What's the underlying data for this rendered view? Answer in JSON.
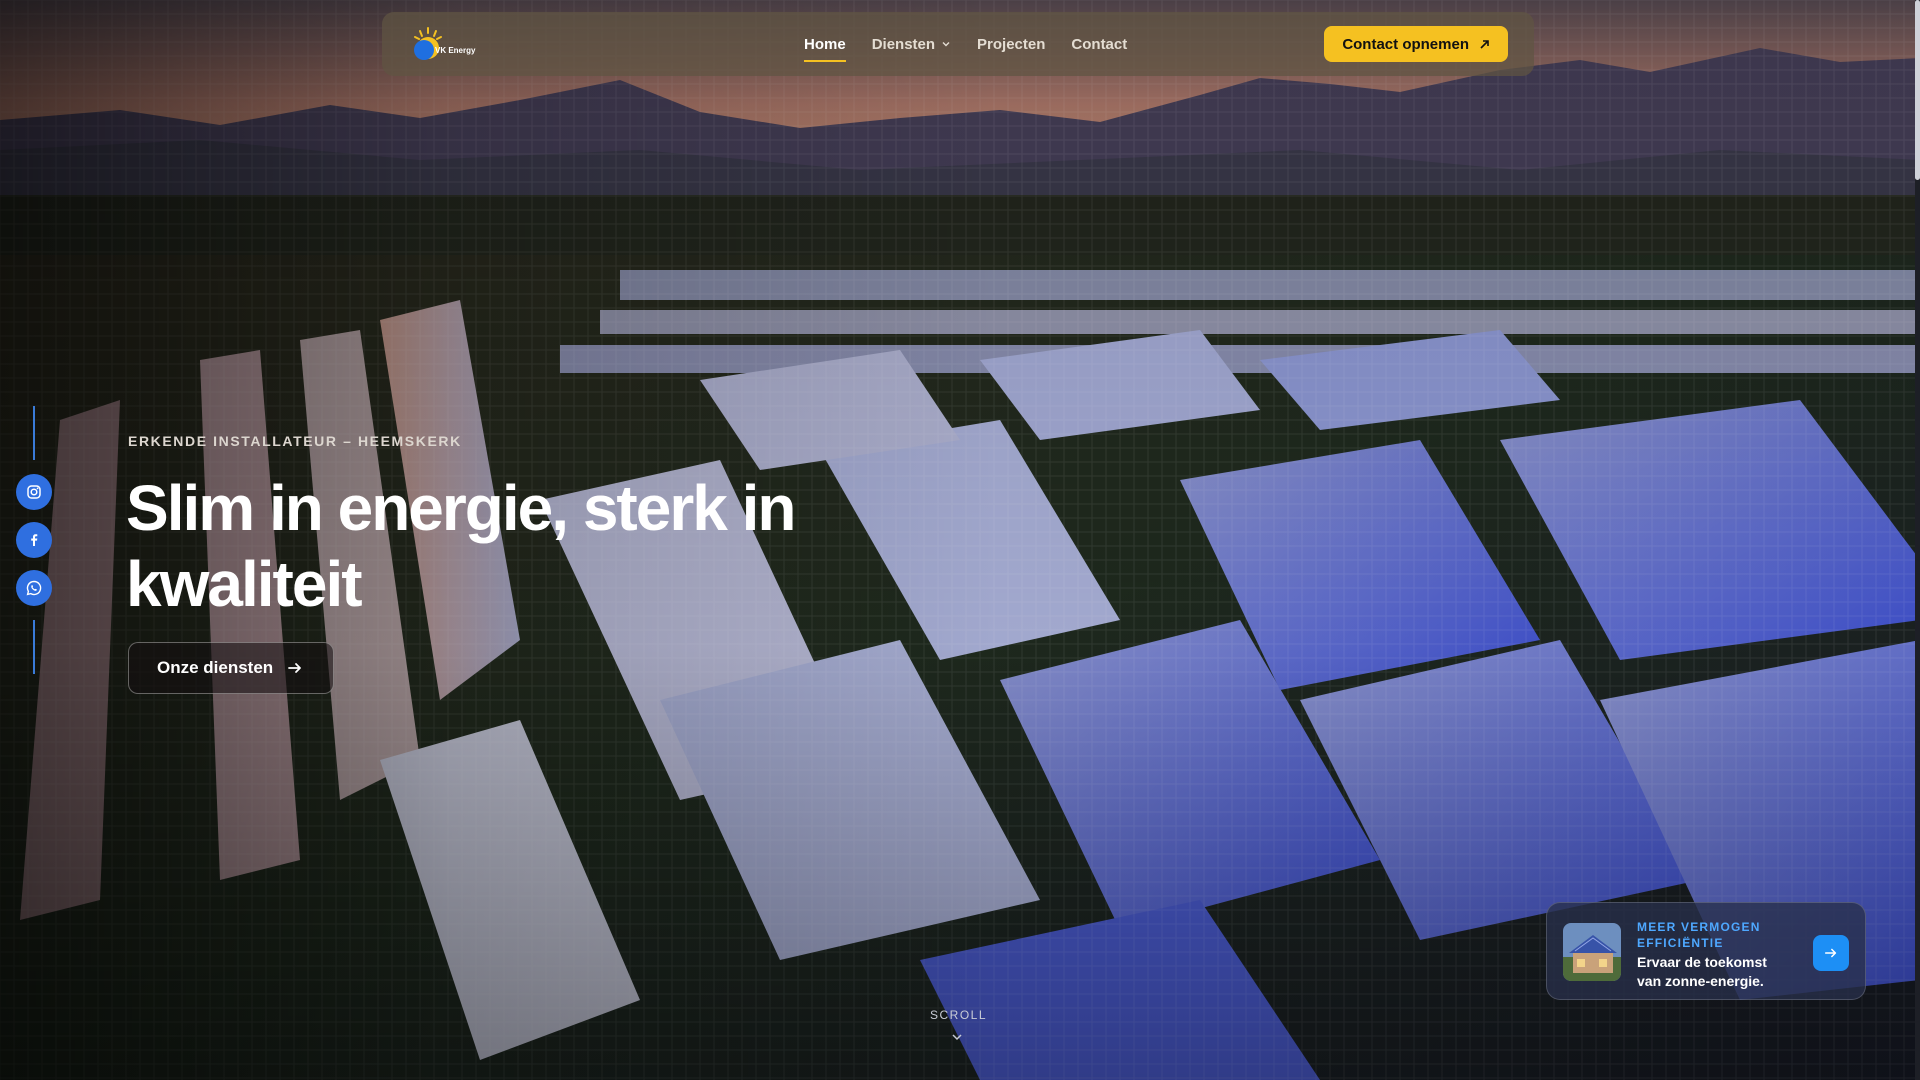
{
  "brand": {
    "logo_text": "VK Energy",
    "accent": "#f5c121",
    "blue": "#2f6fe0"
  },
  "nav": {
    "items": [
      {
        "label": "Home",
        "active": true
      },
      {
        "label": "Diensten",
        "has_dropdown": true
      },
      {
        "label": "Projecten"
      },
      {
        "label": "Contact"
      }
    ],
    "cta_label": "Contact opnemen",
    "cta_icon": "arrow-up-right-icon"
  },
  "social": [
    {
      "name": "instagram",
      "icon": "instagram-icon"
    },
    {
      "name": "facebook",
      "icon": "facebook-icon"
    },
    {
      "name": "whatsapp",
      "icon": "whatsapp-icon"
    }
  ],
  "hero": {
    "eyebrow": "ERKENDE INSTALLATEUR – HEEMSKERK",
    "headline": "Slim in energie, sterk in kwaliteit",
    "button_label": "Onze diensten",
    "button_icon": "arrow-right-icon"
  },
  "promo": {
    "kicker": "MEER VERMOGEN EFFICIËNTIE",
    "title": "Ervaar de toekomst van zonne-energie.",
    "icon": "arrow-right-icon"
  },
  "scroll": {
    "label": "SCROLL",
    "icon": "chevron-down-icon"
  }
}
